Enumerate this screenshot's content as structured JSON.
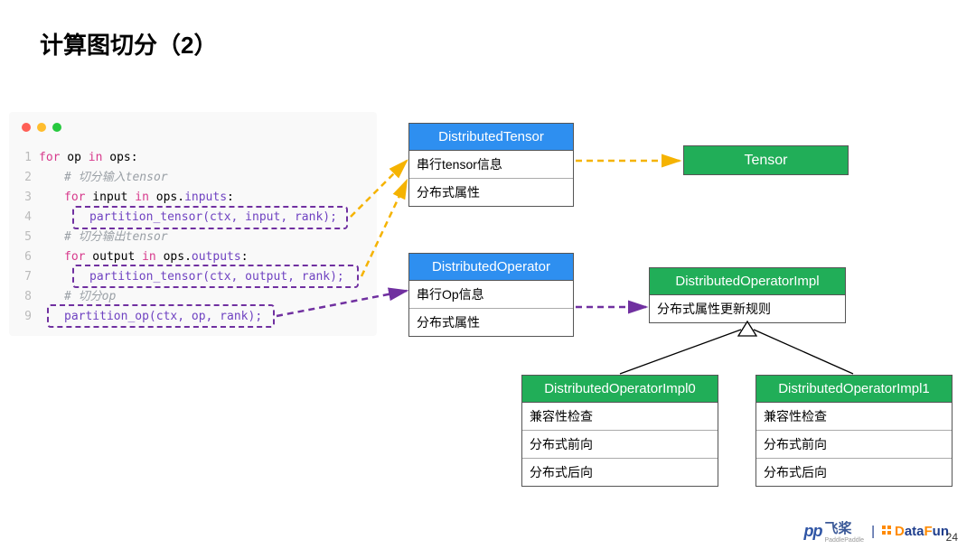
{
  "title": "计算图切分（2）",
  "code": {
    "l1_for": "for",
    "l1_op": " op ",
    "l1_in": "in",
    "l1_ops": " ops:",
    "l2": "# 切分输入tensor",
    "l3_for": "for",
    "l3_a": " input ",
    "l3_in": "in",
    "l3_b": " ops.",
    "l3_c": "inputs",
    "l3_d": ":",
    "l4": "partition_tensor(ctx, input, rank);",
    "l5": "# 切分输出tensor",
    "l6_for": "for",
    "l6_a": " output ",
    "l6_in": "in",
    "l6_b": " ops.",
    "l6_c": "outputs",
    "l6_d": ":",
    "l7": "partition_tensor(ctx, output, rank);",
    "l8": "# 切分op",
    "l9": "partition_op(ctx, op, rank);"
  },
  "boxes": {
    "dtensor_hdr": "DistributedTensor",
    "dtensor_r1": "串行tensor信息",
    "dtensor_r2": "分布式属性",
    "tensor": "Tensor",
    "dop_hdr": "DistributedOperator",
    "dop_r1": "串行Op信息",
    "dop_r2": "分布式属性",
    "dopimpl_hdr": "DistributedOperatorImpl",
    "dopimpl_r1": "分布式属性更新规则",
    "impl0_hdr": "DistributedOperatorImpl0",
    "impl1_hdr": "DistributedOperatorImpl1",
    "impl_r1": "兼容性检查",
    "impl_r2": "分布式前向",
    "impl_r3": "分布式后向"
  },
  "footer": {
    "paddle": "飞桨",
    "paddle_sub": "PaddlePaddle",
    "datafun_a": "D",
    "datafun_b": "ata",
    "datafun_c": "F",
    "datafun_d": "un",
    "slide_num": "24"
  }
}
